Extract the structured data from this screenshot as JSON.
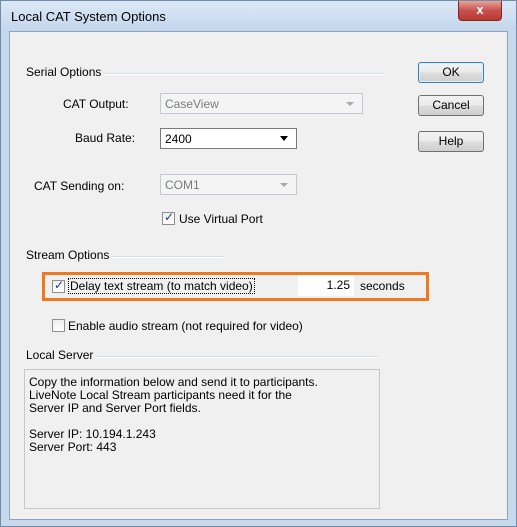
{
  "window": {
    "title": "Local CAT System Options",
    "close_glyph": "x"
  },
  "serial": {
    "group_label": "Serial Options",
    "cat_output_label": "CAT Output:",
    "cat_output_value": "CaseView",
    "baud_label": "Baud Rate:",
    "baud_value": "2400",
    "sending_label": "CAT Sending on:",
    "sending_value": "COM1",
    "virtual_port_label": "Use Virtual Port",
    "virtual_port_checked": true
  },
  "buttons": {
    "ok": "OK",
    "cancel": "Cancel",
    "help": "Help"
  },
  "stream": {
    "group_label": "Stream Options",
    "delay_label": "Delay text stream (to match video)",
    "delay_checked": true,
    "delay_value": "1.25",
    "delay_unit": "seconds",
    "audio_label": "Enable audio stream (not required for video)",
    "audio_checked": false
  },
  "server": {
    "group_label": "Local Server",
    "info_text": "Copy the information below and send it to participants.\nLiveNote Local Stream participants need it for the\nServer IP and Server Port fields.\n\nServer IP: 10.194.1.243\nServer Port: 443"
  },
  "colors": {
    "highlight": "#f0781e",
    "titlebar": "#c9d9ec",
    "close_button": "#c75050"
  }
}
